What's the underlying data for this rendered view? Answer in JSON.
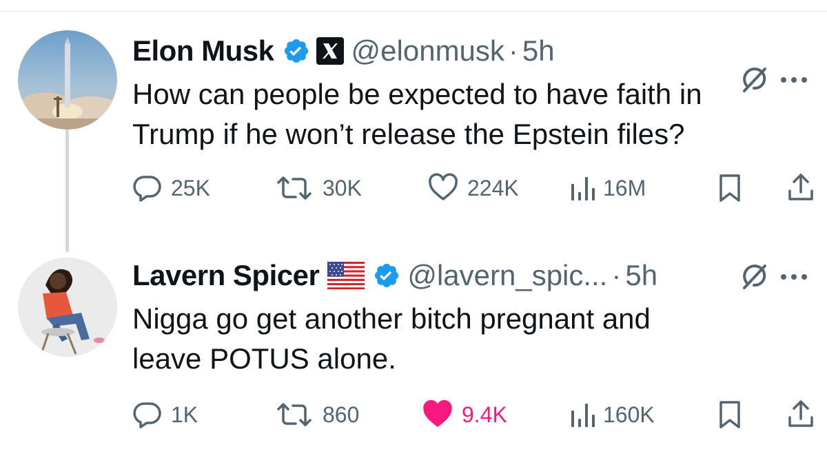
{
  "tweets": [
    {
      "name": "Elon Musk",
      "handle": "@elonmusk",
      "separator": "·",
      "time": "5h",
      "text_lines": [
        "How can people be expected to have faith in",
        "Trump if he won’t release the Epstein files?"
      ],
      "replies": "25K",
      "retweets": "30K",
      "likes": "224K",
      "views": "16M",
      "verified": true,
      "affiliate": "X",
      "liked": false
    },
    {
      "name": "Lavern Spicer",
      "handle": "@lavern_spic...",
      "separator": "·",
      "time": "5h",
      "text_lines": [
        "Nigga go get another bitch pregnant and",
        "leave POTUS alone."
      ],
      "replies": "1K",
      "retweets": "860",
      "likes": "9.4K",
      "views": "160K",
      "verified": true,
      "flag": "us-flag",
      "liked": true
    }
  ],
  "colors": {
    "text": "#0f1419",
    "secondary": "#536471",
    "verified": "#1d9bf0",
    "like_active": "#f91880",
    "thread_line": "#cfd9de"
  },
  "icons": [
    "reply-icon",
    "retweet-icon",
    "like-icon",
    "views-icon",
    "bookmark-icon",
    "share-icon",
    "grok-icon",
    "more-icon",
    "verified-badge-icon",
    "x-logo-icon",
    "us-flag-icon"
  ]
}
